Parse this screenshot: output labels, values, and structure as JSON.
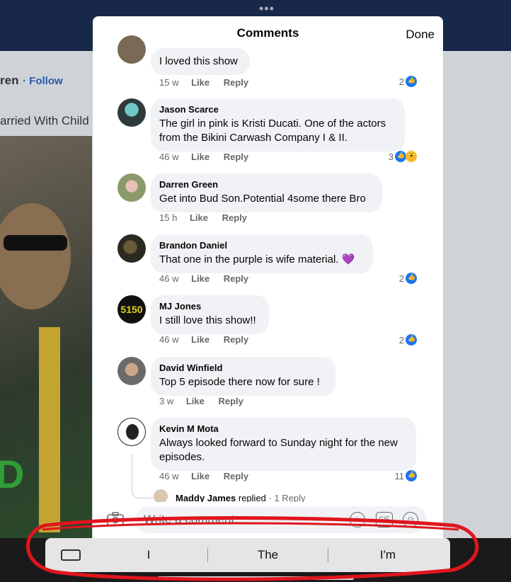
{
  "background": {
    "page_name": "ren",
    "follow_label": "Follow",
    "caption": "arried With Child",
    "video_letter": "D",
    "dots": "•••"
  },
  "modal": {
    "title": "Comments",
    "done_label": "Done"
  },
  "comments": [
    {
      "author": "",
      "text": "I loved this show",
      "time": "15 w",
      "like": "Like",
      "reply": "Reply",
      "reactions": "2"
    },
    {
      "author": "Jason Scarce",
      "text": "The girl in pink is Kristi Ducati. One of the actors from the Bikini Carwash Company I & II.",
      "time": "46 w",
      "like": "Like",
      "reply": "Reply",
      "reactions": "3"
    },
    {
      "author": "Darren Green",
      "text": "Get into Bud Son.Potential 4some there Bro",
      "time": "15 h",
      "like": "Like",
      "reply": "Reply",
      "reactions": ""
    },
    {
      "author": "Brandon Daniel",
      "text": "That one in the purple is wife material. 💜",
      "time": "46 w",
      "like": "Like",
      "reply": "Reply",
      "reactions": "2"
    },
    {
      "author": "MJ Jones",
      "text": "I still love this show!!",
      "time": "46 w",
      "like": "Like",
      "reply": "Reply",
      "reactions": "2"
    },
    {
      "author": "David Winfield",
      "text": "Top 5 episode there now for sure !",
      "time": "3 w",
      "like": "Like",
      "reply": "Reply",
      "reactions": ""
    },
    {
      "author": "Kevin M Mota",
      "text": "Always looked forward to Sunday night for the new episodes.",
      "time": "46 w",
      "like": "Like",
      "reply": "Reply",
      "reactions": "11"
    }
  ],
  "reply_summary": {
    "name": "Maddy James",
    "action": " replied",
    "count": " · 1 Reply"
  },
  "composer": {
    "placeholder": "Write a comment...",
    "gif_label": "GIF"
  },
  "keyboard": {
    "suggestions": [
      "I",
      "The",
      "I'm"
    ]
  },
  "colors": {
    "like_blue": "#1877f2",
    "bubble_gray": "#f0f2f5",
    "annotation_red": "#e0151d"
  }
}
